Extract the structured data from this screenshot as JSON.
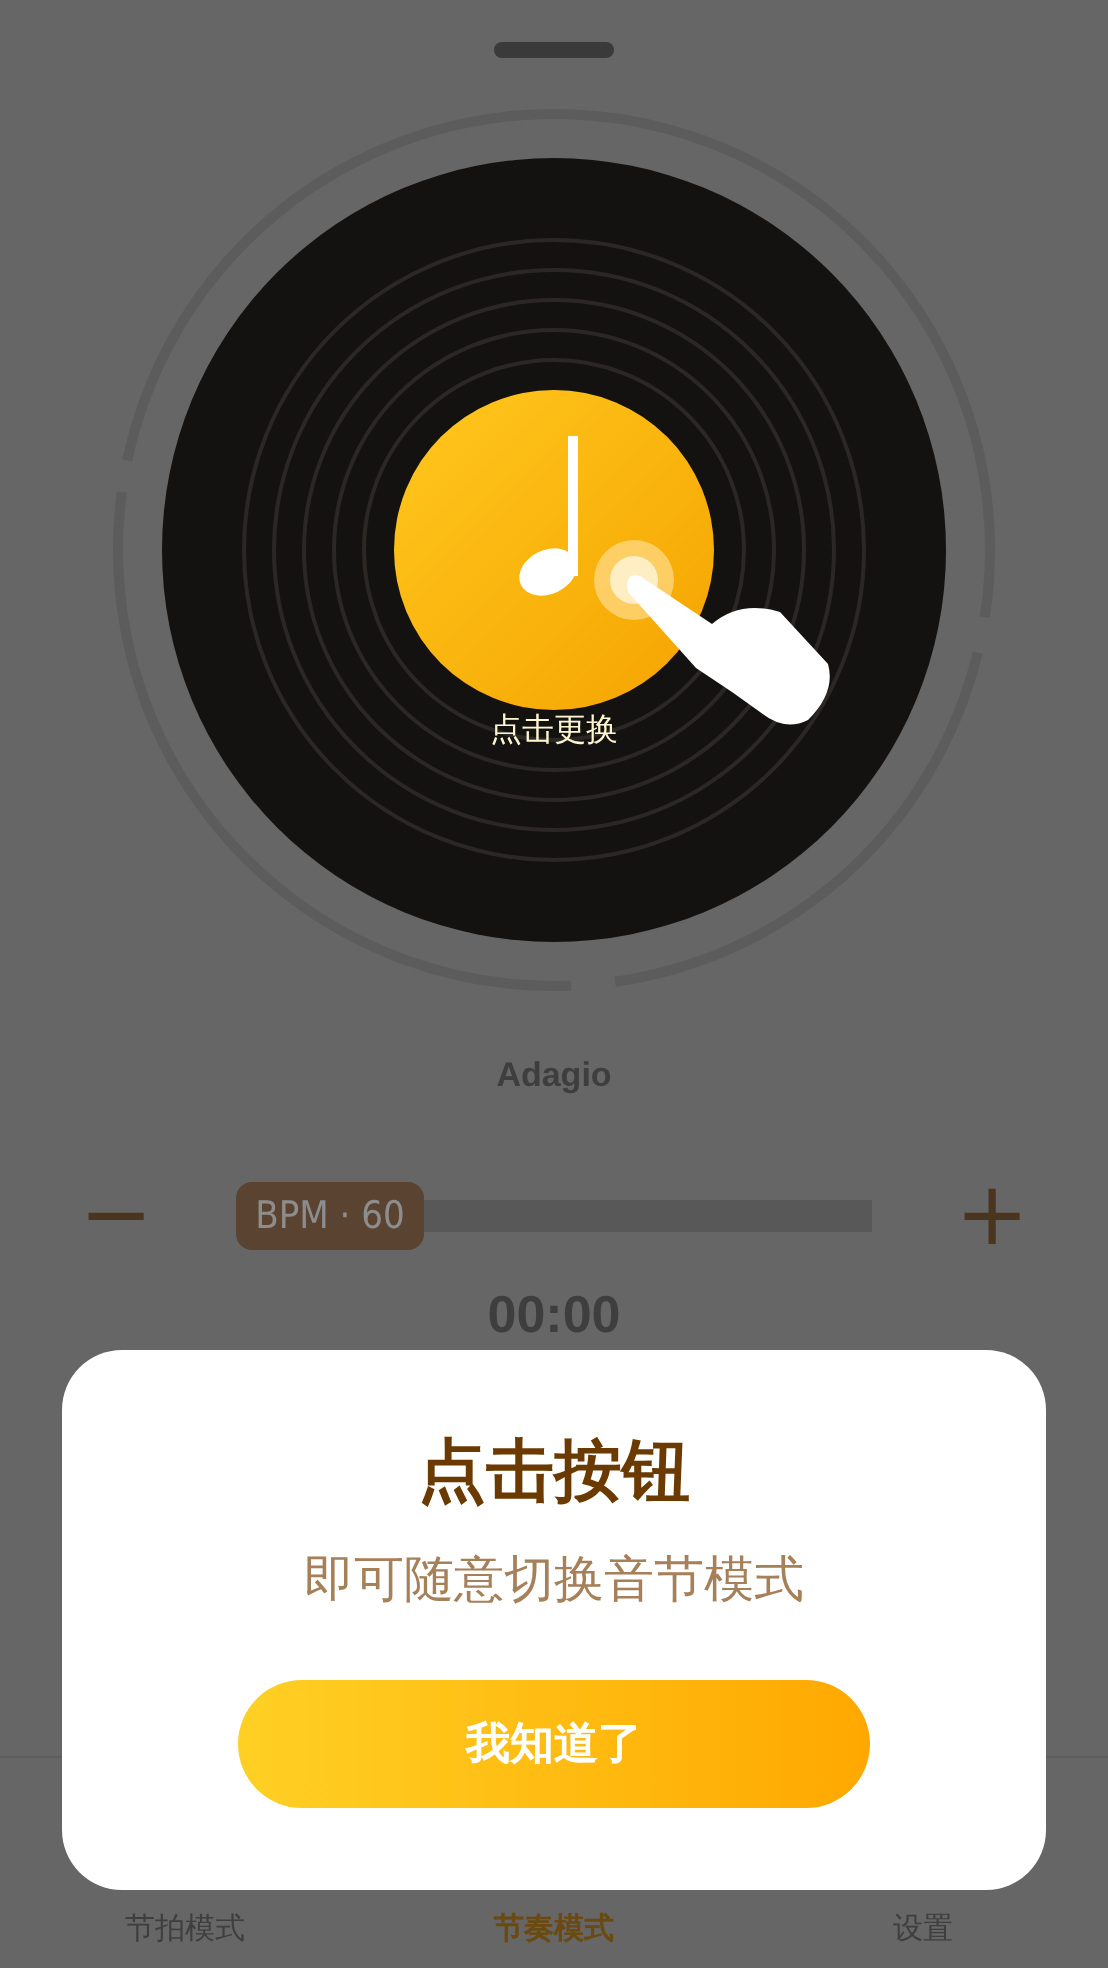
{
  "record": {
    "label": "点击更换"
  },
  "tempo_name": "Adagio",
  "bpm": {
    "minus": "−",
    "plus": "+",
    "label": "BPM · 60",
    "level": 0
  },
  "timer": "00:00",
  "tabs": [
    {
      "label": "节拍模式",
      "selected": false
    },
    {
      "label": "节奏模式",
      "selected": true
    },
    {
      "label": "设置",
      "selected": false
    }
  ],
  "dialog": {
    "title": "点击按钮",
    "message": "即可随意切换音节模式",
    "button": "我知道了"
  }
}
